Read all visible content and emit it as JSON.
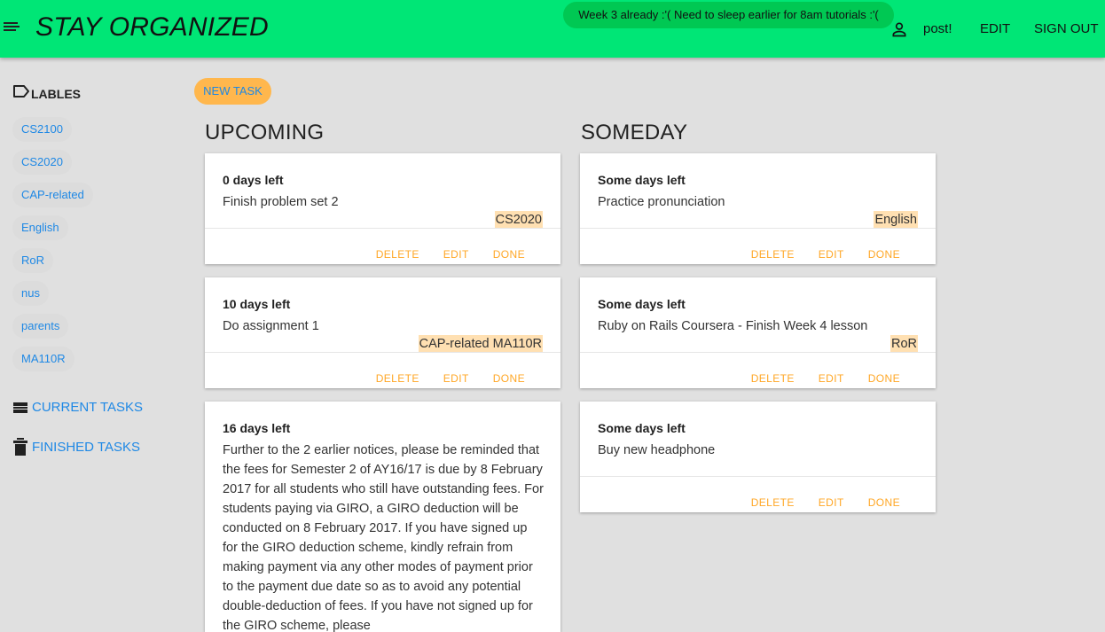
{
  "header": {
    "title": "STAY ORGANIZED",
    "status_message": "Week 3 already :'( Need to sleep earlier for 8am tutorials :'(",
    "username": "post!",
    "edit_label": "EDIT",
    "signout_label": "SIGN OUT"
  },
  "sidebar": {
    "labels_heading": "LABLES",
    "labels": [
      "CS2100",
      "CS2020",
      "CAP-related",
      "English",
      "RoR",
      "nus",
      "parents",
      "MA110R"
    ],
    "current_tasks": "CURRENT TASKS",
    "finished_tasks": "FINISHED TASKS"
  },
  "main": {
    "new_task_label": "NEW TASK",
    "actions": {
      "delete": "DELETE",
      "edit": "EDIT",
      "done": "DONE"
    },
    "upcoming": {
      "title": "UPCOMING",
      "cards": [
        {
          "days": "0 days left",
          "description": "Finish problem set 2",
          "tags": "CS2020"
        },
        {
          "days": "10 days left",
          "description": "Do assignment 1",
          "tags": "CAP-related MA110R"
        },
        {
          "days": "16 days left",
          "description": "Further to the 2 earlier notices, please be reminded that the fees for Semester 2 of AY16/17 is due by 8 February 2017 for all students who still have outstanding fees. For students paying via GIRO, a GIRO deduction will be conducted on 8 February 2017. If you have signed up for the GIRO deduction scheme, kindly refrain from making payment via any other modes of payment prior to the payment due date so as to avoid any potential double-deduction of fees. If you have not signed up for the GIRO scheme, please",
          "tags": ""
        }
      ]
    },
    "someday": {
      "title": "SOMEDAY",
      "cards": [
        {
          "days": "Some days left",
          "description": "Practice pronunciation",
          "tags": "English"
        },
        {
          "days": "Some days left",
          "description": "Ruby on Rails Coursera - Finish Week 4 lesson",
          "tags": "RoR"
        },
        {
          "days": "Some days left",
          "description": "Buy new headphone",
          "tags": ""
        }
      ]
    }
  },
  "colors": {
    "topbar": "#00e676",
    "status_chip": "#00c853",
    "accent_blue": "#1e88e5",
    "action_orange": "#ffa726",
    "tag_highlight": "#ffe0b2",
    "new_task_button": "#ffb74d"
  },
  "icons": [
    "menu-icon",
    "person-icon",
    "label-icon",
    "list-icon",
    "trash-icon"
  ]
}
